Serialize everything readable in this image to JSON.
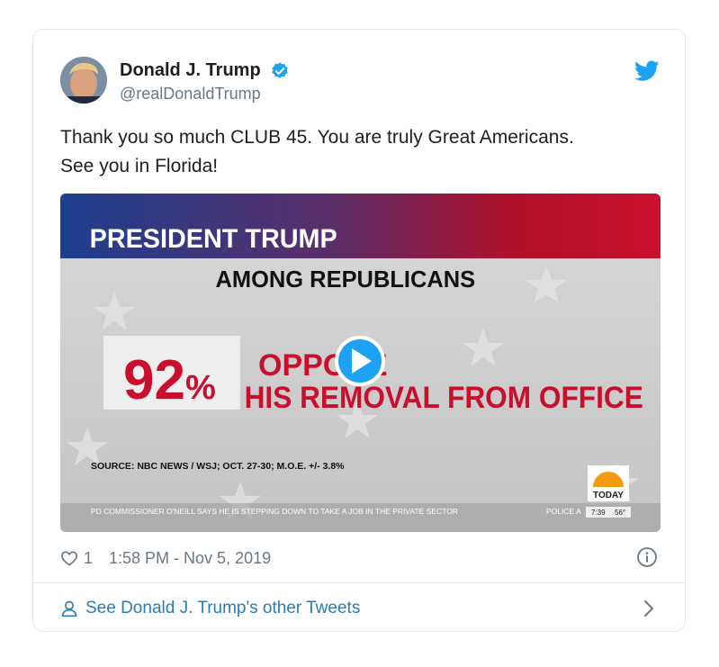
{
  "user": {
    "display_name": "Donald J. Trump",
    "handle": "@realDonaldTrump"
  },
  "tweet": {
    "line1": "Thank you so much CLUB 45. You are truly Great Americans.",
    "line2": "See you in Florida!"
  },
  "media": {
    "banner": "PRESIDENT TRUMP",
    "subtitle": "AMONG REPUBLICANS",
    "percent_number": "92",
    "percent_sign": "%",
    "line_a": "OPPOSE",
    "line_b": "HIS REMOVAL FROM OFFICE",
    "source": "SOURCE: NBC NEWS / WSJ; OCT. 27-30; M.O.E. +/- 3.8%",
    "ticker": "PD COMMISSIONER  O'NEILL SAYS HE IS STEPPING DOWN TO TAKE A JOB IN THE PRIVATE SECTOR",
    "ticker_tail": "POLICE A",
    "network_logo": "TODAY",
    "clock": "7:39",
    "temperature": "56°"
  },
  "meta": {
    "likes": "1",
    "timestamp": "1:58 PM - Nov 5, 2019"
  },
  "footer": {
    "link": "See Donald J. Trump's other Tweets"
  },
  "colors": {
    "accent": "#1da1f2",
    "link": "#2b7bb9",
    "muted": "#697882",
    "poll_red": "#c8102e"
  }
}
